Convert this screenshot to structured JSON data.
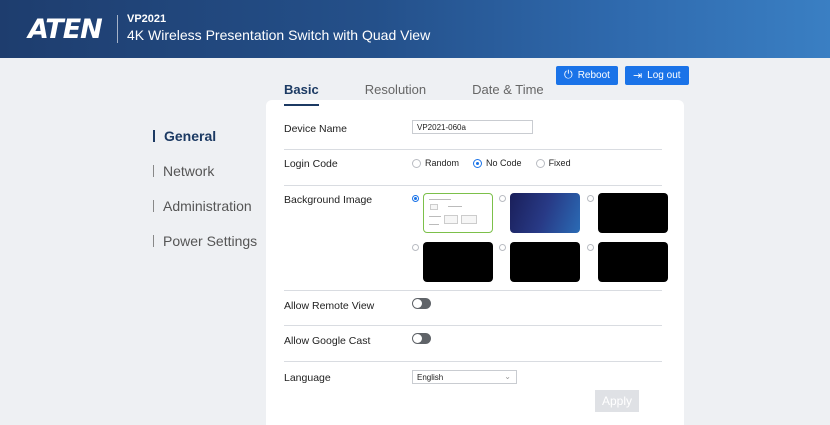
{
  "header": {
    "brand": "ATEN",
    "model": "VP2021",
    "product_name": "4K Wireless Presentation Switch with Quad View"
  },
  "actions": {
    "reboot_label": "Reboot",
    "logout_label": "Log out"
  },
  "sidebar": {
    "items": [
      {
        "label": "General",
        "active": true
      },
      {
        "label": "Network",
        "active": false
      },
      {
        "label": "Administration",
        "active": false
      },
      {
        "label": "Power Settings",
        "active": false
      }
    ]
  },
  "tabs": [
    {
      "label": "Basic",
      "active": true
    },
    {
      "label": "Resolution",
      "active": false
    },
    {
      "label": "Date & Time",
      "active": false
    }
  ],
  "form": {
    "device_name": {
      "label": "Device Name",
      "value": "VP2021-060a"
    },
    "login_code": {
      "label": "Login Code",
      "options": [
        "Random",
        "No Code",
        "Fixed"
      ],
      "selected": "No Code"
    },
    "background_image": {
      "label": "Background Image",
      "selected_index": 0,
      "thumbnails": [
        "default",
        "gradient",
        "black",
        "black",
        "black",
        "black"
      ]
    },
    "allow_remote_view": {
      "label": "Allow Remote View",
      "enabled": false
    },
    "allow_google_cast": {
      "label": "Allow Google Cast",
      "enabled": false
    },
    "language": {
      "label": "Language",
      "value": "English"
    },
    "apply_label": "Apply"
  },
  "colors": {
    "accent": "#1a73e8",
    "nav_active": "#1c3a63",
    "selected_thumbnail_border": "#7cc04a"
  }
}
